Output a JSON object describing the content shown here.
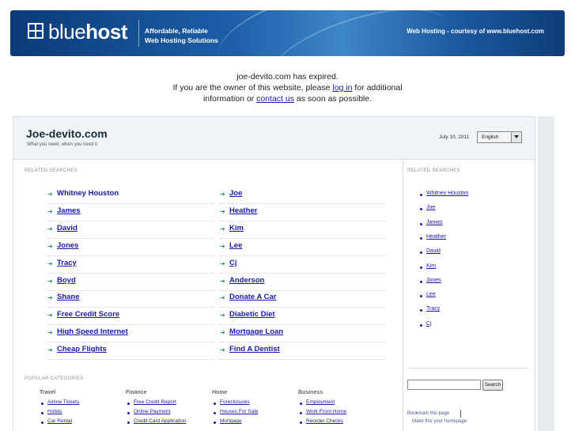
{
  "banner": {
    "brand_light": "blue",
    "brand_bold": "host",
    "tagline_line1": "Affordable, Reliable",
    "tagline_line2": "Web Hosting Solutions",
    "courtesy": "Web Hosting - courtesy of www.bluehost.com"
  },
  "notice": {
    "line1": "joe-devito.com has expired.",
    "line2_pre": "If you are the owner of this website, please ",
    "login_link": "log in",
    "line2_post": " for additional",
    "line3_pre": "information or ",
    "contact_link": "contact us",
    "line3_post": " as soon as possible."
  },
  "header": {
    "site_title": "Joe-devito.com",
    "site_subtitle": "What you need, when you need it",
    "date": "July 10, 2011",
    "language": "English"
  },
  "related": {
    "label": "RELATED SEARCHES",
    "left": [
      "Whitney Houston",
      "James",
      "David",
      "Jones",
      "Tracy",
      "Boyd",
      "Shane",
      "Free Credit Score",
      "High Speed Internet",
      "Cheap Flights"
    ],
    "right": [
      "Joe",
      "Heather",
      "Kim",
      "Lee",
      "Cj",
      "Anderson",
      "Donate A Car",
      "Diabetic Diet",
      "Mortgage Loan",
      "Find A Dentist"
    ]
  },
  "sidebar": {
    "label": "RELATED SEARCHES",
    "items": [
      "Whitney Houston",
      "Joe",
      "James",
      "Heather",
      "David",
      "Kim",
      "Jones",
      "Lee",
      "Tracy",
      "Cj"
    ],
    "search_button": "Search",
    "bookmark": "Bookmark this page",
    "homepage": "Make this your homepage"
  },
  "popular": {
    "label": "POPULAR CATEGORIES",
    "columns": [
      {
        "title": "Travel",
        "items": [
          "Airline Tickets",
          "Hotels",
          "Car Rental"
        ]
      },
      {
        "title": "Finance",
        "items": [
          "Free Credit Report",
          "Online Payment",
          "Credit Card Application"
        ]
      },
      {
        "title": "Home",
        "items": [
          "Foreclosures",
          "Houses For Sale",
          "Mortgage"
        ]
      },
      {
        "title": "Business",
        "items": [
          "Employment",
          "Work From Home",
          "Reorder Checks"
        ]
      }
    ]
  }
}
